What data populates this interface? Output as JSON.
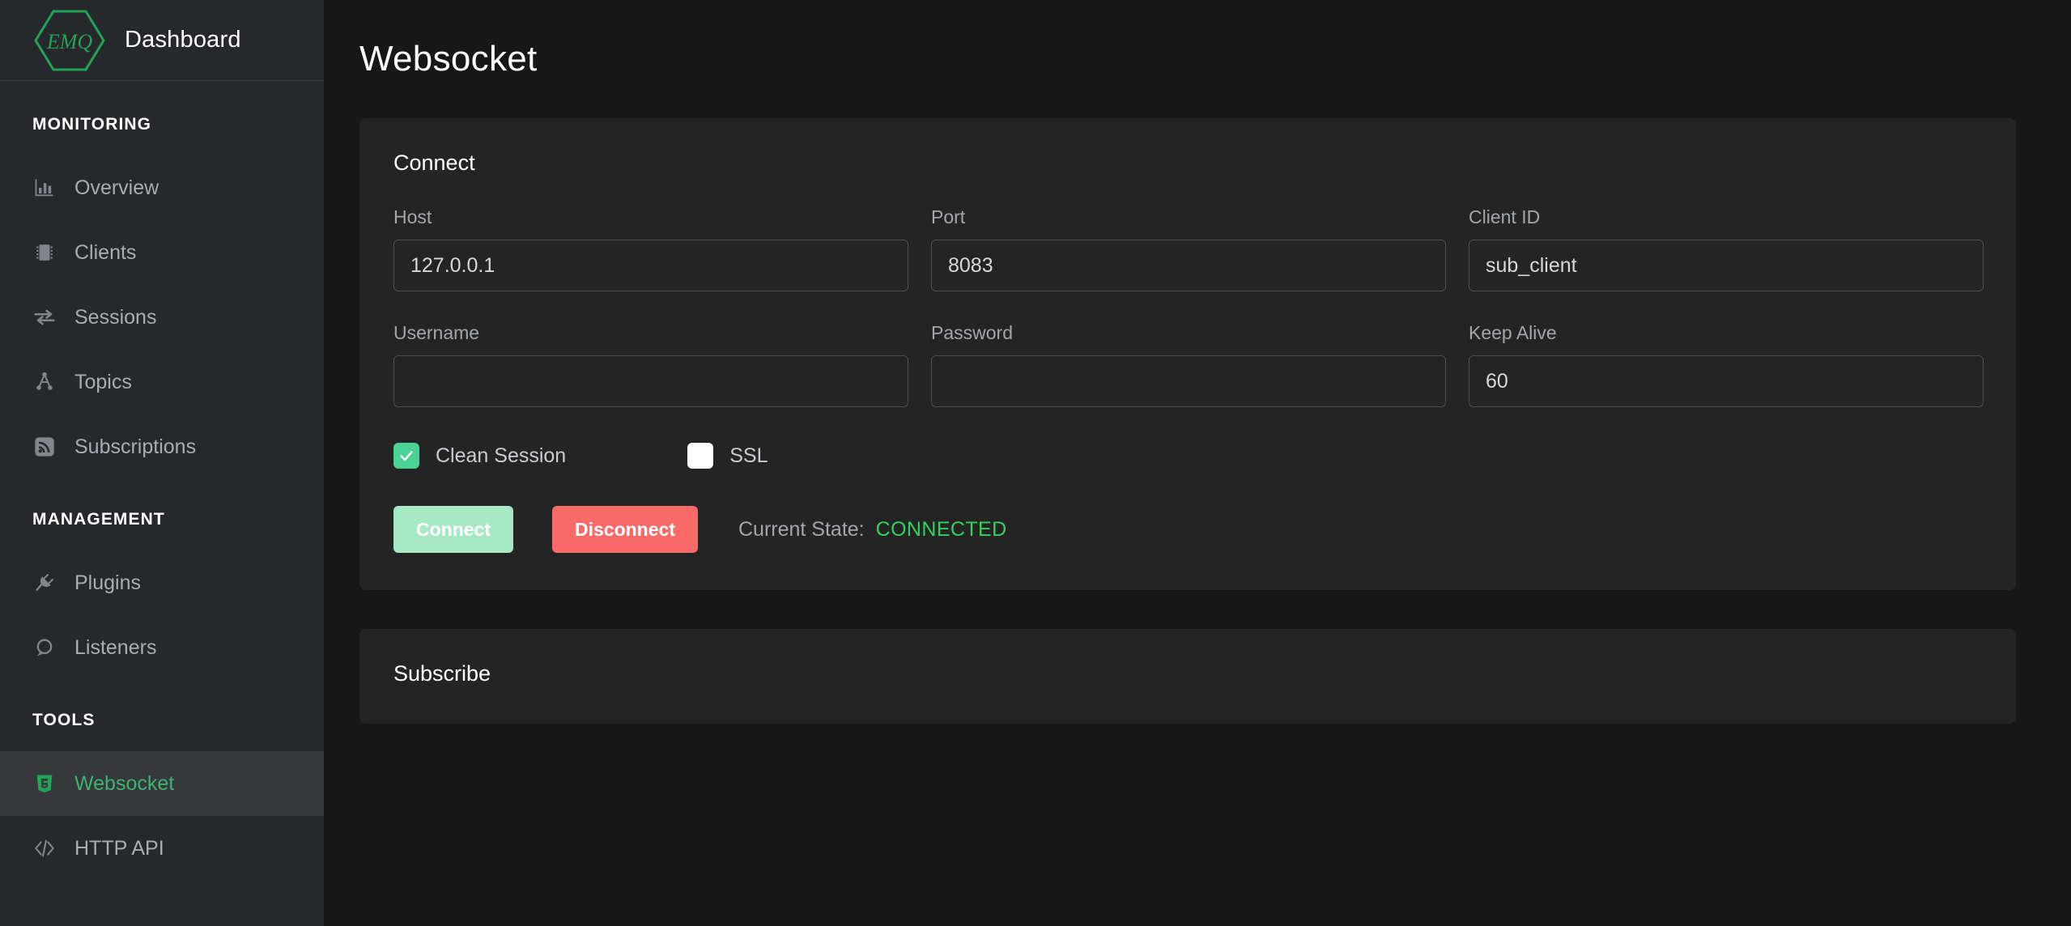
{
  "brand": {
    "logo_text": "EMQ",
    "title": "Dashboard",
    "logo_color": "#23a455"
  },
  "sidebar": {
    "sections": [
      {
        "title": "MONITORING",
        "items": [
          {
            "label": "Overview",
            "icon": "bar-chart-icon",
            "active": false
          },
          {
            "label": "Clients",
            "icon": "chip-icon",
            "active": false
          },
          {
            "label": "Sessions",
            "icon": "exchange-arrows-icon",
            "active": false
          },
          {
            "label": "Topics",
            "icon": "topic-tree-icon",
            "active": false
          },
          {
            "label": "Subscriptions",
            "icon": "rss-feed-icon",
            "active": false
          }
        ]
      },
      {
        "title": "MANAGEMENT",
        "items": [
          {
            "label": "Plugins",
            "icon": "plug-icon",
            "active": false
          },
          {
            "label": "Listeners",
            "icon": "listener-icon",
            "active": false
          }
        ]
      },
      {
        "title": "TOOLS",
        "items": [
          {
            "label": "Websocket",
            "icon": "html5-shield-icon",
            "active": true
          },
          {
            "label": "HTTP API",
            "icon": "code-brackets-icon",
            "active": false
          }
        ]
      }
    ]
  },
  "page": {
    "title": "Websocket"
  },
  "connect_card": {
    "title": "Connect",
    "fields": [
      {
        "label": "Host",
        "value": "127.0.0.1",
        "placeholder": ""
      },
      {
        "label": "Port",
        "value": "8083",
        "placeholder": ""
      },
      {
        "label": "Client ID",
        "value": "sub_client",
        "placeholder": ""
      },
      {
        "label": "Username",
        "value": "",
        "placeholder": ""
      },
      {
        "label": "Password",
        "value": "",
        "placeholder": ""
      },
      {
        "label": "Keep Alive",
        "value": "60",
        "placeholder": ""
      }
    ],
    "checkboxes": [
      {
        "label": "Clean Session",
        "checked": true
      },
      {
        "label": "SSL",
        "checked": false
      }
    ],
    "buttons": {
      "connect": "Connect",
      "disconnect": "Disconnect"
    },
    "state": {
      "label": "Current State:",
      "value": "CONNECTED",
      "color": "#2fd35e"
    }
  },
  "subscribe_card": {
    "title": "Subscribe"
  }
}
